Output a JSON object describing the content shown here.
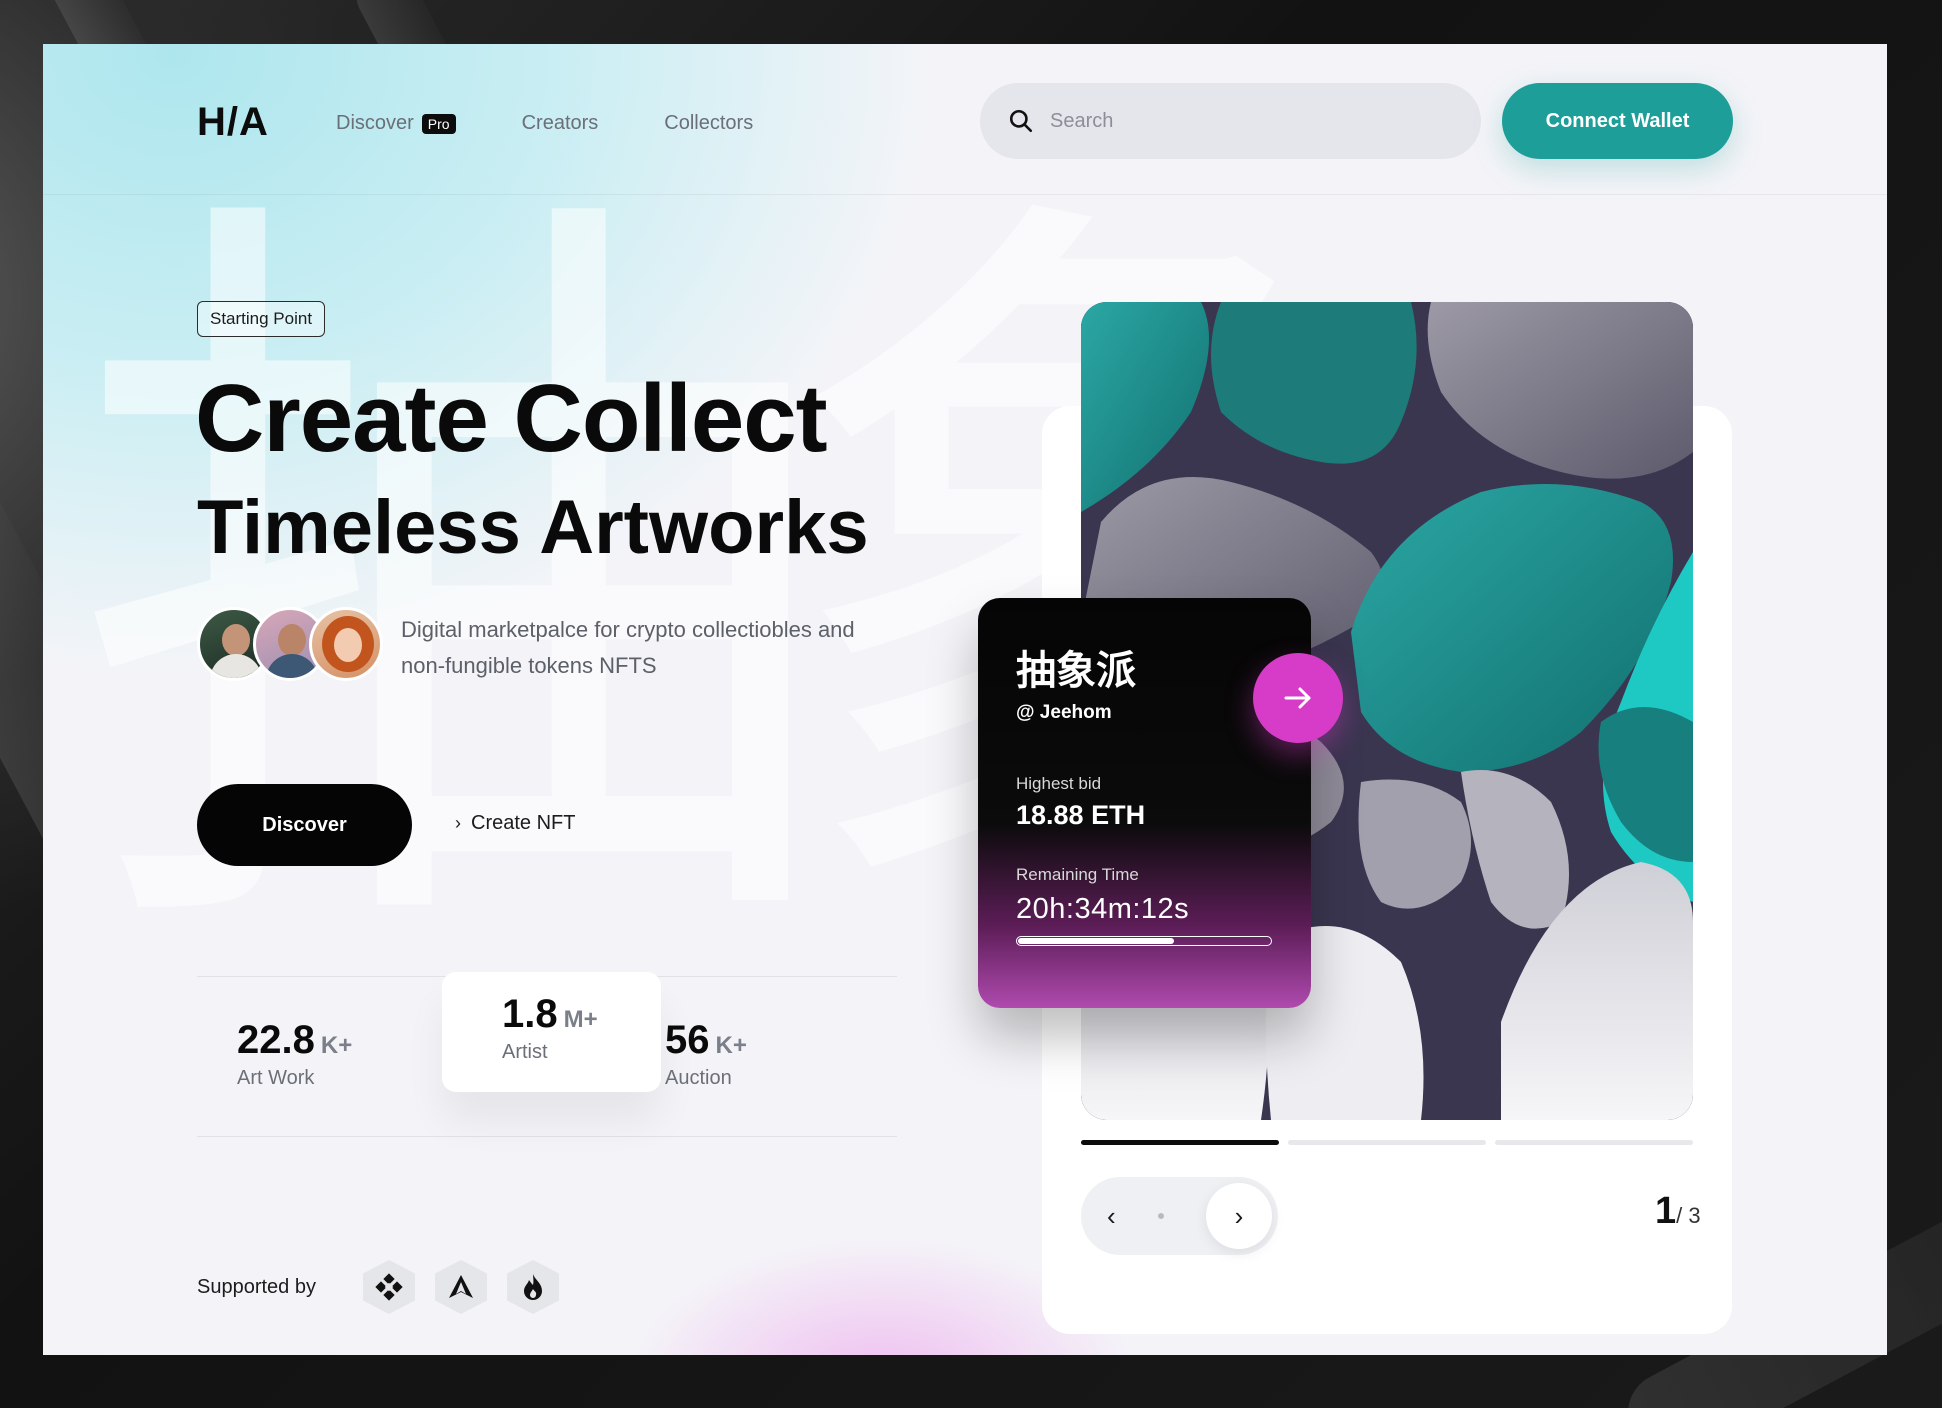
{
  "header": {
    "logo": "H/A",
    "nav": [
      {
        "label": "Discover",
        "badge": "Pro"
      },
      {
        "label": "Creators"
      },
      {
        "label": "Collectors"
      }
    ],
    "search_placeholder": "Search",
    "connect_label": "Connect Wallet"
  },
  "hero": {
    "tag": "Starting Point",
    "title_line1": "Create Collect",
    "title_line2": "Timeless Artworks",
    "description": "Digital marketpalce for crypto collectiobles and non-fungible tokens NFTS",
    "discover_label": "Discover",
    "create_label": "Create NFT"
  },
  "stats": [
    {
      "value": "22.8",
      "suffix": "K+",
      "label": "Art Work"
    },
    {
      "value": "1.8",
      "suffix": "M+",
      "label": "Artist"
    },
    {
      "value": "56",
      "suffix": "K+",
      "label": "Auction"
    }
  ],
  "supported": {
    "label": "Supported by",
    "sponsors": [
      "binance-icon",
      "arweave-icon",
      "flame-icon"
    ]
  },
  "bid": {
    "title": "抽象派",
    "handle": "@ Jeehom",
    "highest_label": "Highest bid",
    "highest_value": "18.88 ETH",
    "remaining_label": "Remaining Time",
    "remaining_value": "20h:34m:12s",
    "remaining_progress": 0.62
  },
  "carousel": {
    "current": "1",
    "total": "/ 3",
    "active_segment": 0
  },
  "colors": {
    "accent": "#1e9e99",
    "magenta": "#d63cc7"
  }
}
